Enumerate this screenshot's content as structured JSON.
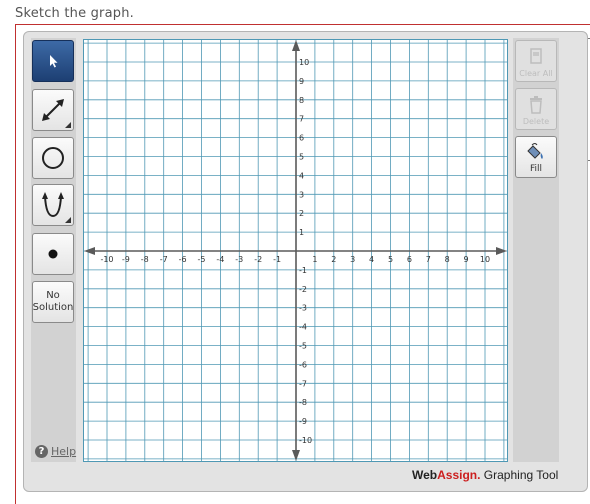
{
  "prompt": "Sketch the graph.",
  "tools": [
    {
      "name": "select",
      "icon": "arrow-pointer-icon",
      "active": true
    },
    {
      "name": "line",
      "icon": "line-segment-icon",
      "active": false
    },
    {
      "name": "circle",
      "icon": "circle-icon",
      "active": false
    },
    {
      "name": "parabola",
      "icon": "parabola-icon",
      "active": false
    },
    {
      "name": "point",
      "icon": "point-icon",
      "active": false
    }
  ],
  "no_solution": {
    "line1": "No",
    "line2": "Solution"
  },
  "help": {
    "icon": "?",
    "label": "Help"
  },
  "actions": {
    "clear_all": {
      "label": "Clear All",
      "icon": "clear-all-icon",
      "enabled": false
    },
    "delete": {
      "label": "Delete",
      "icon": "trash-icon",
      "enabled": false
    },
    "fill": {
      "label": "Fill",
      "icon": "paint-bucket-icon",
      "enabled": true
    }
  },
  "graph": {
    "x_range": [
      -11,
      11
    ],
    "y_range": [
      -11,
      11
    ],
    "tick_labels_x": [
      -10,
      -9,
      -8,
      -7,
      -6,
      -5,
      -4,
      -3,
      -2,
      -1,
      1,
      2,
      3,
      4,
      5,
      6,
      7,
      8,
      9,
      10
    ],
    "tick_labels_y": [
      10,
      9,
      8,
      7,
      6,
      5,
      4,
      3,
      2,
      1,
      -1,
      -2,
      -3,
      -4,
      -5,
      -6,
      -7,
      -8,
      -9,
      -10
    ]
  },
  "branding": {
    "web": "Web",
    "assign": "Assign.",
    "tail": " Graphing Tool",
    "accent_color": "#cc1f1f"
  },
  "colors": {
    "grid": "#4f98b4",
    "axis": "#5a5a5a",
    "active_tool": "#2b5590"
  }
}
